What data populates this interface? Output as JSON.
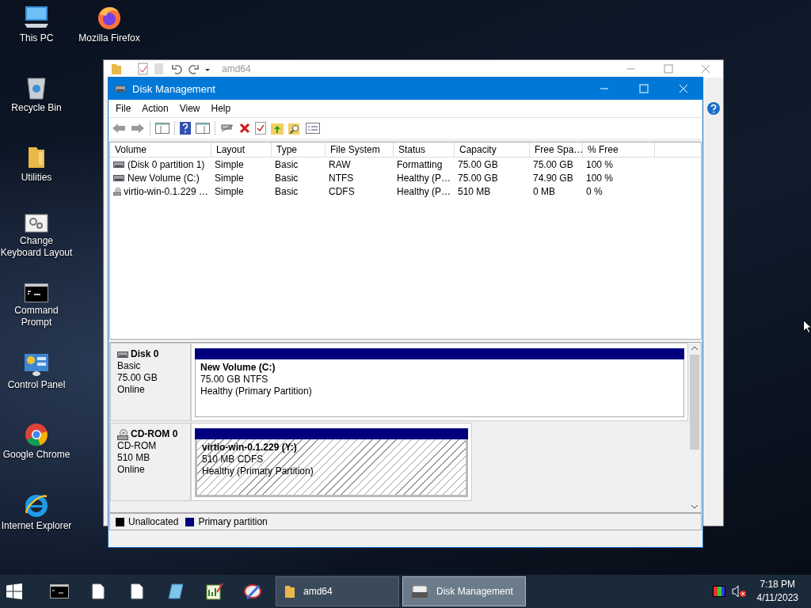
{
  "desktop_icons": [
    {
      "label": "This PC",
      "kind": "computer"
    },
    {
      "label": "Recycle Bin",
      "kind": "recycle"
    },
    {
      "label": "Utilities",
      "kind": "folder"
    },
    {
      "label": "Change Keyboard Layout",
      "kind": "settings"
    },
    {
      "label": "Command Prompt",
      "kind": "console"
    },
    {
      "label": "Control Panel",
      "kind": "control"
    },
    {
      "label": "Google Chrome",
      "kind": "chrome"
    },
    {
      "label": "Internet Explorer",
      "kind": "ie"
    },
    {
      "label": "Mozilla Firefox",
      "kind": "firefox"
    }
  ],
  "background_window": {
    "title": "amd64"
  },
  "window": {
    "title": "Disk Management",
    "menu": [
      "File",
      "Action",
      "View",
      "Help"
    ]
  },
  "table": {
    "columns": [
      "Volume",
      "Layout",
      "Type",
      "File System",
      "Status",
      "Capacity",
      "Free Spa…",
      "% Free"
    ],
    "rows": [
      {
        "kind": "disk",
        "cells": [
          "(Disk 0 partition 1)",
          "Simple",
          "Basic",
          "RAW",
          "Formatting",
          "75.00 GB",
          "75.00 GB",
          "100 %"
        ]
      },
      {
        "kind": "disk",
        "cells": [
          "New Volume (C:)",
          "Simple",
          "Basic",
          "NTFS",
          "Healthy (P…",
          "75.00 GB",
          "74.90 GB",
          "100 %"
        ]
      },
      {
        "kind": "cdrom",
        "cells": [
          "virtio-win-0.1.229 …",
          "Simple",
          "Basic",
          "CDFS",
          "Healthy (P…",
          "510 MB",
          "0 MB",
          "0 %"
        ]
      }
    ]
  },
  "disks": [
    {
      "kind": "disk",
      "name": "Disk 0",
      "type": "Basic",
      "size": "75.00 GB",
      "status": "Online",
      "partitions": [
        {
          "name": "New Volume  (C:)",
          "info": "75.00 GB NTFS",
          "status": "Healthy (Primary Partition)",
          "selected": false
        }
      ]
    },
    {
      "kind": "cdrom",
      "name": "CD-ROM 0",
      "type": "CD-ROM",
      "size": "510 MB",
      "status": "Online",
      "partitions": [
        {
          "name": "virtio-win-0.1.229  (Y:)",
          "info": "510 MB CDFS",
          "status": "Healthy (Primary Partition)",
          "selected": true
        }
      ]
    }
  ],
  "legend": [
    {
      "label": "Unallocated",
      "color": "#000000"
    },
    {
      "label": "Primary partition",
      "color": "#00007f"
    }
  ],
  "taskbar": {
    "pinned": [
      {
        "kind": "console"
      },
      {
        "kind": "file"
      },
      {
        "kind": "file"
      },
      {
        "kind": "notebook"
      },
      {
        "kind": "chart"
      },
      {
        "kind": "tool"
      }
    ],
    "tasks": [
      {
        "label": "amd64",
        "kind": "folder",
        "selected": false
      },
      {
        "label": "Disk Management",
        "kind": "disk",
        "selected": true
      }
    ],
    "volume_muted": true,
    "time": "7:18 PM",
    "date": "4/11/2023"
  }
}
